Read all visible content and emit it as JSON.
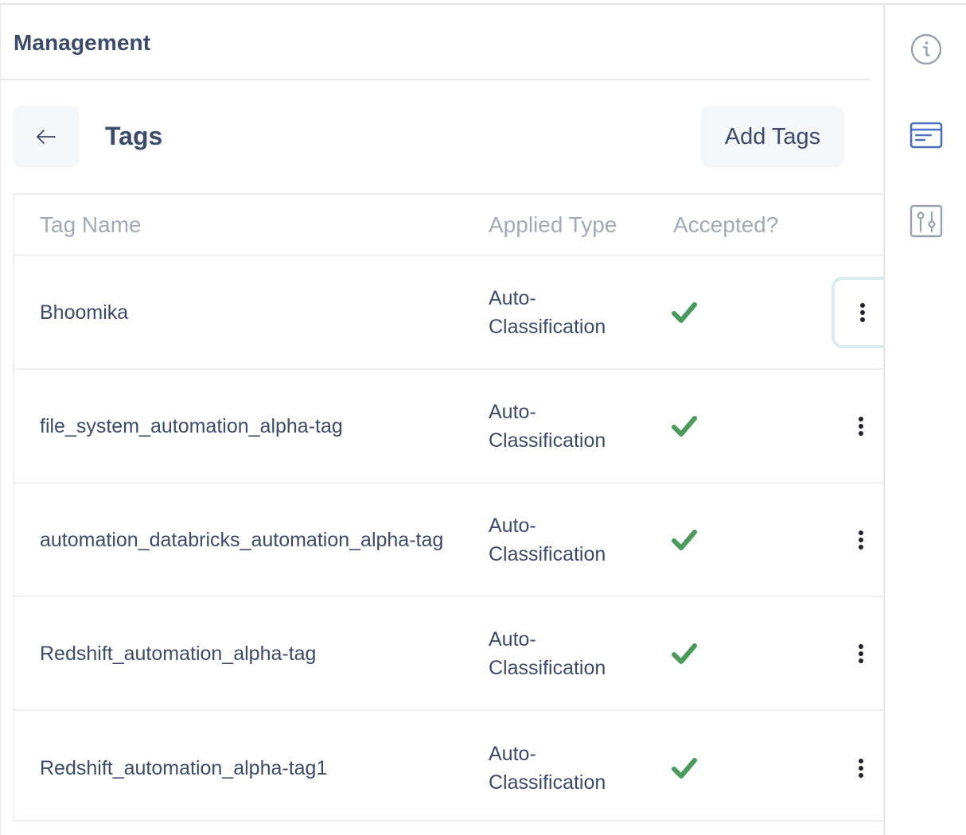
{
  "panel": {
    "title": "Management"
  },
  "header": {
    "back_icon": "arrow-left-icon",
    "section_title": "Tags",
    "add_button_label": "Add Tags"
  },
  "table": {
    "columns": [
      "Tag Name",
      "Applied Type",
      "Accepted?"
    ],
    "rows": [
      {
        "name": "Bhoomika",
        "type": "Auto-\nClassification",
        "accepted": true,
        "menu_icon": "more-vertical-icon",
        "menu_focused": true
      },
      {
        "name": "file_system_automation_alpha-tag",
        "type": "Auto-\nClassification",
        "accepted": true,
        "menu_icon": "more-vertical-icon",
        "menu_focused": false
      },
      {
        "name": "automation_databricks_automation_alpha-tag",
        "type": "Auto-\nClassification",
        "accepted": true,
        "menu_icon": "more-vertical-icon",
        "menu_focused": false
      },
      {
        "name": "Redshift_automation_alpha-tag",
        "type": "Auto-\nClassification",
        "accepted": true,
        "menu_icon": "more-vertical-icon",
        "menu_focused": false
      },
      {
        "name": "Redshift_automation_alpha-tag1",
        "type": "Auto-\nClassification",
        "accepted": true,
        "menu_icon": "more-vertical-icon",
        "menu_focused": false
      }
    ]
  },
  "rail": {
    "icons": [
      "info-icon",
      "card-icon",
      "settings-sliders-icon"
    ],
    "active_index": 1
  },
  "colors": {
    "text_primary": "#3d4a6b",
    "text_muted": "#a2a9b8",
    "check_green": "#4a9a5c",
    "rail_active": "#4a6fc1",
    "rail_inactive": "#9aa2b1",
    "button_bg": "#f5f6f8",
    "focus_ring": "#dcebf0"
  }
}
